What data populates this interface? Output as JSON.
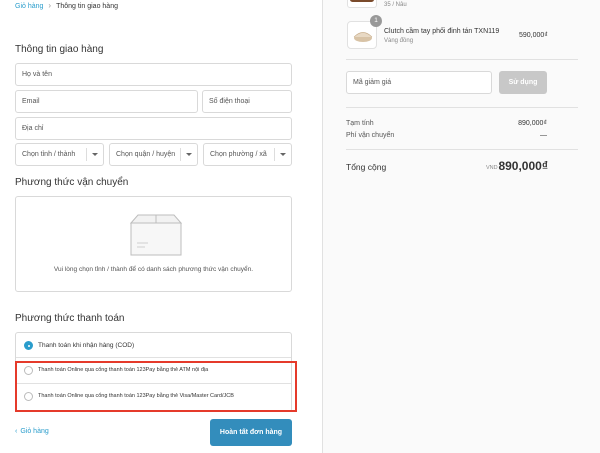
{
  "breadcrumb": {
    "cart": "Giỏ hàng",
    "current": "Thông tin giao hàng"
  },
  "shipping_info": {
    "title": "Thông tin giao hàng",
    "name_placeholder": "Họ và tên",
    "email_placeholder": "Email",
    "phone_placeholder": "Số điện thoại",
    "address_placeholder": "Địa chỉ",
    "province": "Chọn tỉnh / thành",
    "district": "Chọn quận / huyện",
    "ward": "Chọn phường / xã"
  },
  "shipping_method": {
    "title": "Phương thức vận chuyển",
    "message": "Vui lòng chọn tỉnh / thành để có danh sách phương thức vận chuyển."
  },
  "payment": {
    "title": "Phương thức thanh toán",
    "options": [
      {
        "label": "Thanh toán khi nhận hàng (COD)",
        "selected": true
      },
      {
        "label": "Thanh toán Online qua cổng thanh toán 123Pay bằng thẻ ATM nội địa",
        "selected": false
      },
      {
        "label": "Thanh toán Online qua cổng thanh toán 123Pay bằng thẻ Visa/Master Card/JCB",
        "selected": false
      }
    ]
  },
  "footer": {
    "back": "Giỏ hàng",
    "submit": "Hoàn tất đơn hàng"
  },
  "order": {
    "item1_variant": "35 / Nâu",
    "item2": {
      "quantity": "1",
      "name": "Clutch cầm tay phối đinh tán TXN119",
      "variant": "Vàng đồng",
      "price": "590,000₫"
    },
    "coupon_placeholder": "Mã giảm giá",
    "apply": "Sử dụng",
    "subtotal_label": "Tạm tính",
    "subtotal": "890,000₫",
    "shipping_label": "Phí vận chuyển",
    "shipping": "—",
    "total_label": "Tổng cộng",
    "currency": "VND",
    "total": "890,000₫"
  },
  "colors": {
    "accent": "#338dbc",
    "link": "#2a9dcc",
    "highlight": "#e53a2b"
  }
}
